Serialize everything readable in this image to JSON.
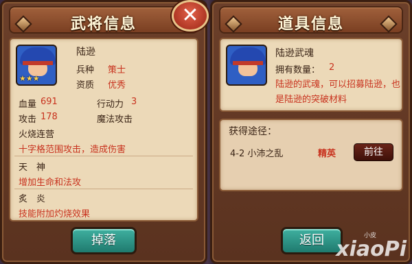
{
  "left_panel": {
    "title": "武将信息",
    "hero": {
      "name": "陆逊",
      "stars": "★★★",
      "type_label": "兵种",
      "type_value": "策士",
      "quality_label": "资质",
      "quality_value": "优秀",
      "hp_label": "血量",
      "hp_value": "691",
      "action_label": "行动力",
      "action_value": "3",
      "attack_label": "攻击",
      "attack_value": "178",
      "attack_type": "魔法攻击"
    },
    "skills": [
      {
        "name": "火烧连营",
        "desc": "十字格范围攻击，造成伤害"
      },
      {
        "name": "天　神",
        "desc": "增加生命和法攻"
      },
      {
        "name": "炙　炎",
        "desc": "技能附加灼烧效果"
      }
    ],
    "drop_button": "掉落"
  },
  "close_icon": "✕",
  "right_panel": {
    "title": "道具信息",
    "item": {
      "name": "陆逊武魂",
      "count_label": "拥有数量：",
      "count_value": "2",
      "description": "陆逊的武魂，可以招募陆逊，也是陆逊的突破材料"
    },
    "source_title": "获得途径：",
    "source": {
      "stage": "4-2 小沛之乱",
      "difficulty": "精英",
      "go_button": "前往"
    },
    "back_button": "返回"
  },
  "watermark": {
    "main": "xiaoPi",
    "small": "小皮"
  }
}
